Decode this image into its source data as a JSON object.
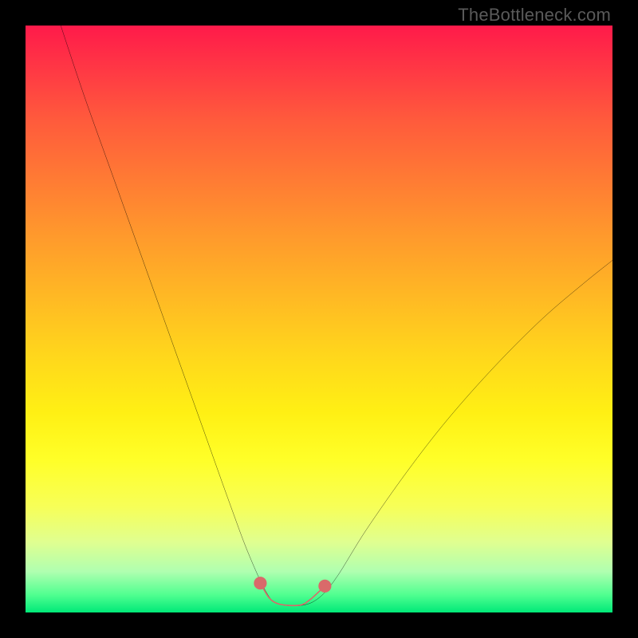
{
  "watermark": "TheBottleneck.com",
  "chart_data": {
    "type": "line",
    "title": "",
    "xlabel": "",
    "ylabel": "",
    "xlim": [
      0,
      100
    ],
    "ylim": [
      0,
      100
    ],
    "series": [
      {
        "name": "bottleneck-curve",
        "points": [
          {
            "x": 6,
            "y": 100
          },
          {
            "x": 10,
            "y": 88
          },
          {
            "x": 15,
            "y": 74
          },
          {
            "x": 20,
            "y": 60
          },
          {
            "x": 25,
            "y": 46
          },
          {
            "x": 30,
            "y": 32
          },
          {
            "x": 35,
            "y": 18
          },
          {
            "x": 38,
            "y": 10
          },
          {
            "x": 41,
            "y": 3.5
          },
          {
            "x": 43,
            "y": 1.5
          },
          {
            "x": 47,
            "y": 1.2
          },
          {
            "x": 50,
            "y": 2.5
          },
          {
            "x": 53,
            "y": 6
          },
          {
            "x": 58,
            "y": 14
          },
          {
            "x": 65,
            "y": 24
          },
          {
            "x": 72,
            "y": 33
          },
          {
            "x": 80,
            "y": 42
          },
          {
            "x": 88,
            "y": 50
          },
          {
            "x": 95,
            "y": 56
          },
          {
            "x": 100,
            "y": 60
          }
        ]
      },
      {
        "name": "valley-highlight",
        "points": [
          {
            "x": 40,
            "y": 5
          },
          {
            "x": 41.5,
            "y": 2.5
          },
          {
            "x": 43,
            "y": 1.5
          },
          {
            "x": 45,
            "y": 1.2
          },
          {
            "x": 47,
            "y": 1.3
          },
          {
            "x": 48.5,
            "y": 2.2
          },
          {
            "x": 51,
            "y": 4.5
          }
        ]
      }
    ],
    "highlight_endpoints": [
      {
        "x": 40,
        "y": 5
      },
      {
        "x": 51,
        "y": 4.5
      }
    ],
    "colors": {
      "curve": "#000000",
      "highlight": "#d96a6a",
      "gradient_top": "#ff1a4a",
      "gradient_bottom": "#00e878"
    }
  }
}
